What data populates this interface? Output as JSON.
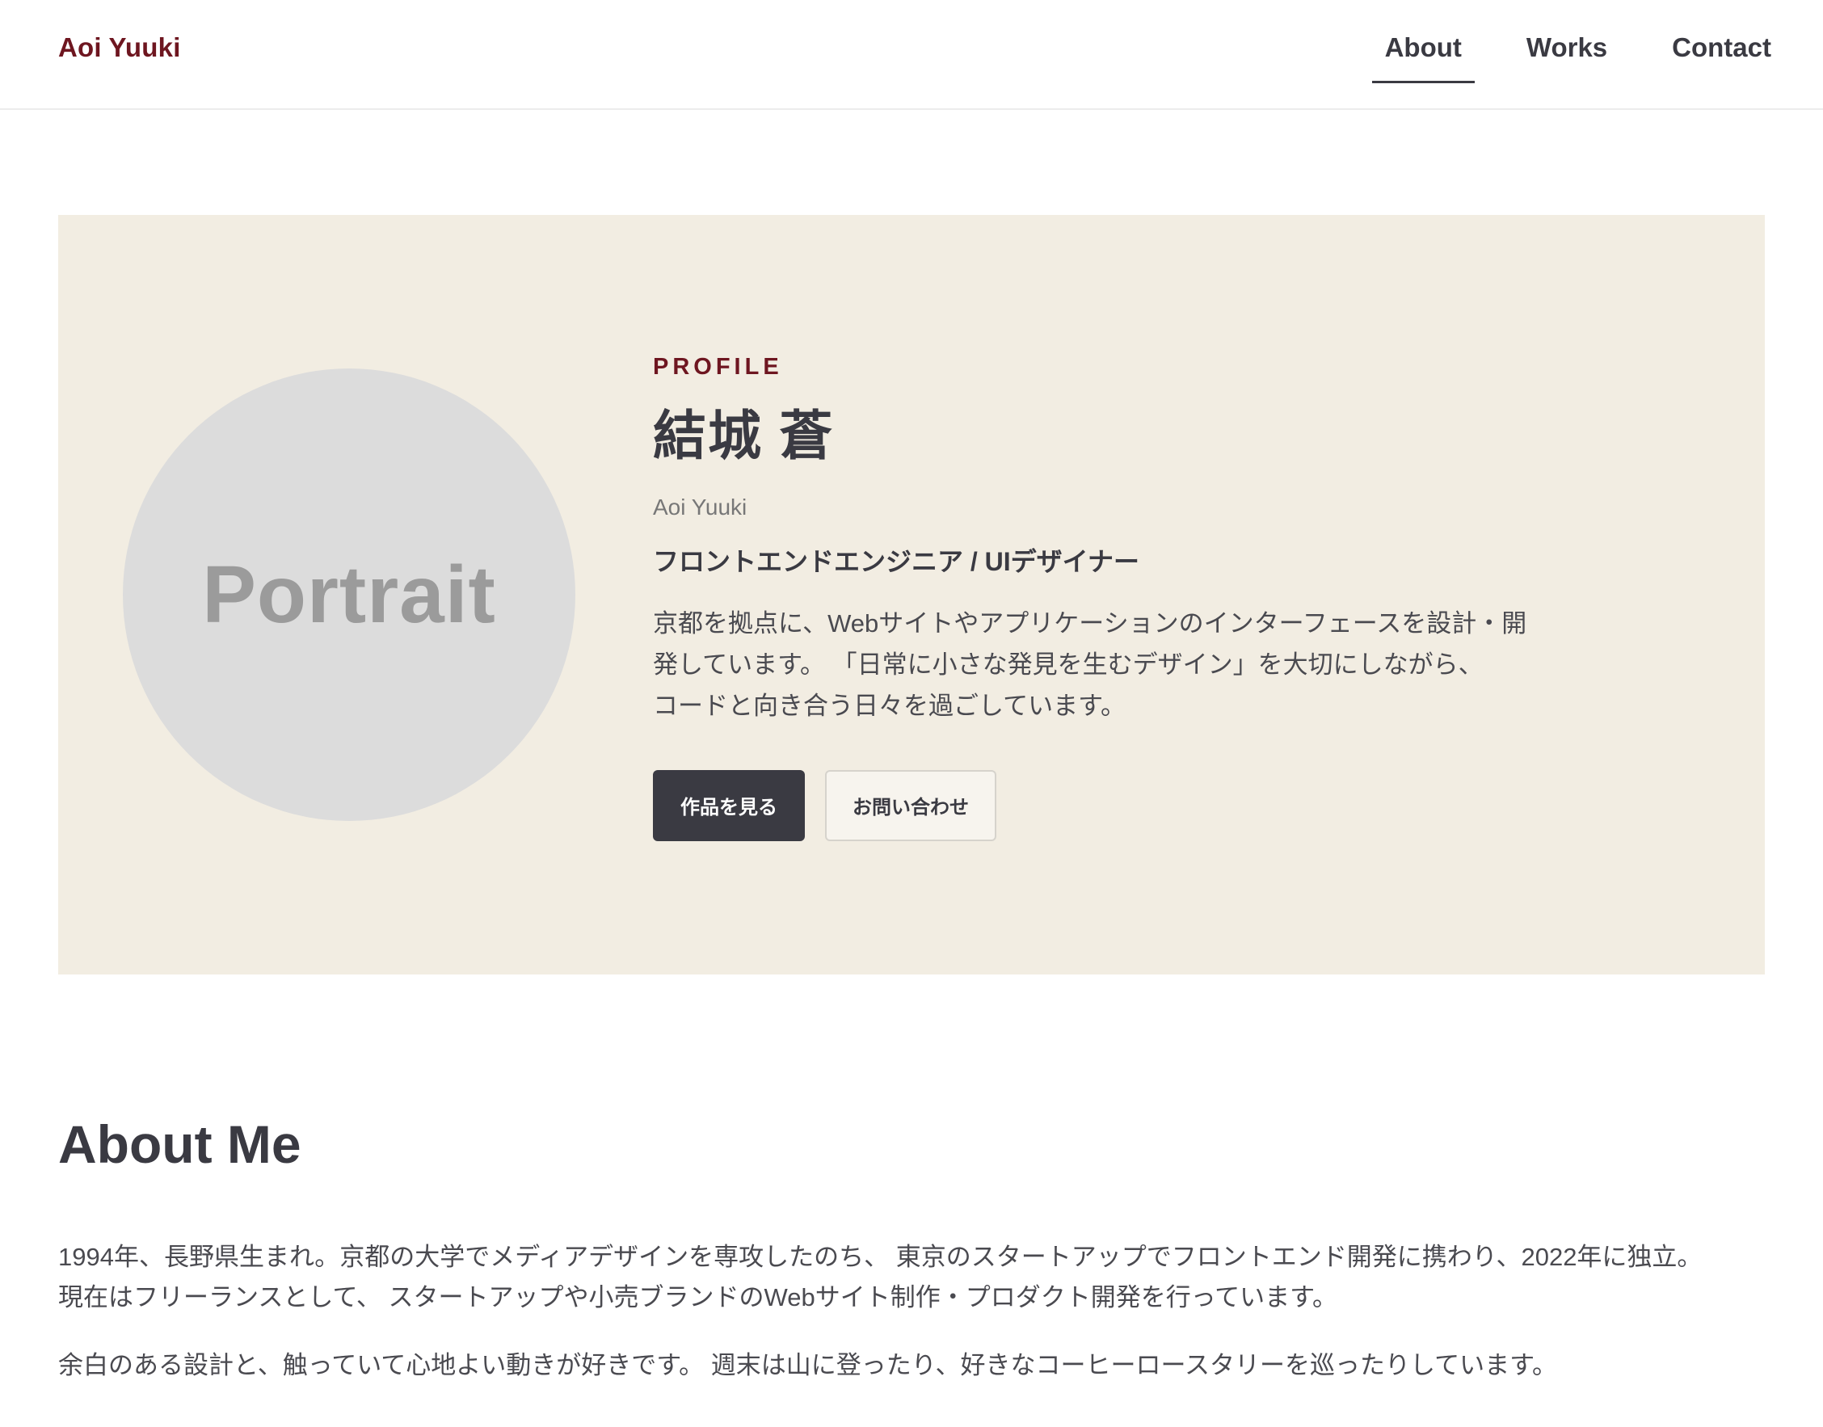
{
  "header": {
    "brand": "Aoi Yuuki",
    "nav": [
      {
        "label": "About",
        "active": true
      },
      {
        "label": "Works",
        "active": false
      },
      {
        "label": "Contact",
        "active": false
      }
    ]
  },
  "hero": {
    "portrait_label": "Portrait",
    "eyebrow": "PROFILE",
    "name_jp": "結城 蒼",
    "name_en": "Aoi Yuuki",
    "role": "フロントエンドエンジニア / UIデザイナー",
    "bio_lines": [
      "京都を拠点に、Webサイトやアプリケーションのインターフェースを設計・開",
      "発しています。 「日常に小さな発見を生むデザイン」を大切にしながら、",
      "コードと向き合う日々を過ごしています。"
    ],
    "buttons": {
      "primary": "作品を見る",
      "secondary": "お問い合わせ"
    }
  },
  "about": {
    "title": "About Me",
    "paragraph1_lines": [
      "1994年、長野県生まれ。京都の大学でメディアデザインを専攻したのち、 東京のスタートアップでフロントエンド開発に携わり、2022年に独立。",
      "現在はフリーランスとして、 スタートアップや小売ブランドのWebサイト制作・プロダクト開発を行っています。"
    ],
    "paragraph2": "余白のある設計と、触っていて心地よい動きが好きです。 週末は山に登ったり、好きなコーヒーロースタリーを巡ったりしています。"
  },
  "colors": {
    "accent": "#6e1620",
    "text": "#3a3a42",
    "hero_bg": "#f2ede2",
    "portrait_bg": "#dcdcdc"
  }
}
